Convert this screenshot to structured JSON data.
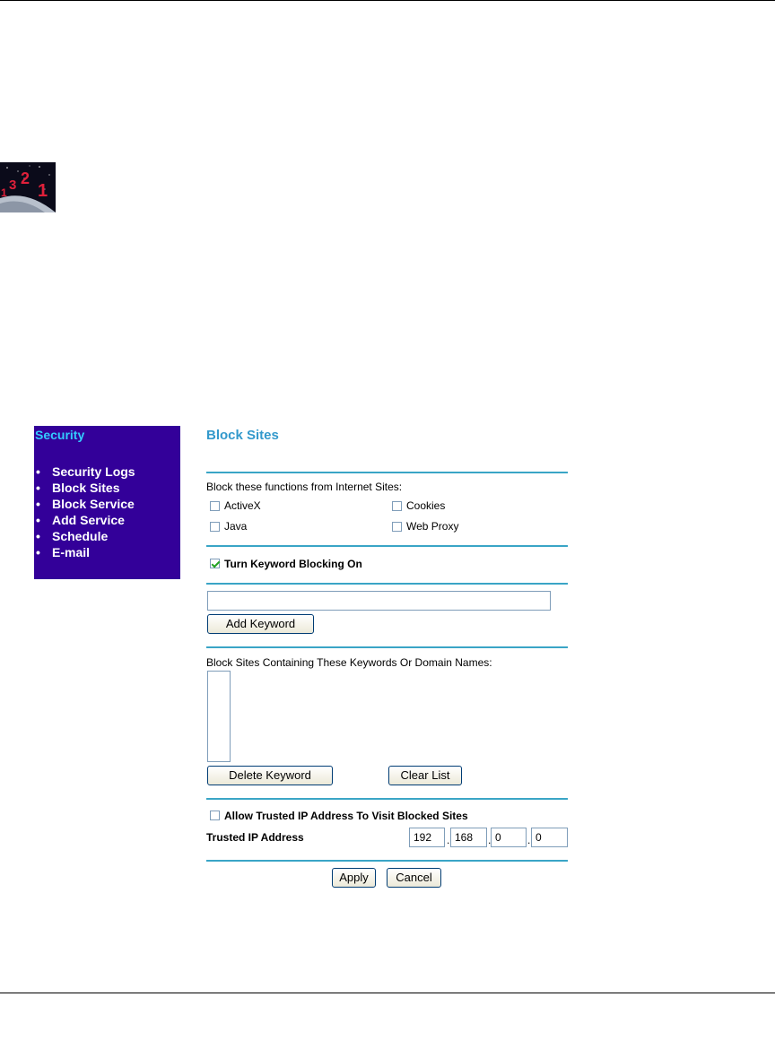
{
  "sidebar": {
    "title": "Security",
    "items": [
      {
        "label": "Security Logs"
      },
      {
        "label": "Block Sites"
      },
      {
        "label": "Block Service"
      },
      {
        "label": "Add Service"
      },
      {
        "label": "Schedule"
      },
      {
        "label": "E-mail"
      }
    ]
  },
  "main": {
    "title": "Block Sites",
    "block_functions_label": "Block these functions from Internet Sites:",
    "functions": {
      "activex": {
        "label": "ActiveX",
        "checked": false
      },
      "cookies": {
        "label": "Cookies",
        "checked": false
      },
      "java": {
        "label": "Java",
        "checked": false
      },
      "web_proxy": {
        "label": "Web Proxy",
        "checked": false
      }
    },
    "keyword_blocking": {
      "label": "Turn Keyword Blocking On",
      "checked": true
    },
    "keyword_input_value": "",
    "add_keyword_label": "Add Keyword",
    "list_label": "Block Sites Containing These Keywords Or Domain Names:",
    "list_items": [],
    "delete_keyword_label": "Delete Keyword",
    "clear_list_label": "Clear List",
    "trusted": {
      "allow_label": "Allow Trusted IP Address To Visit Blocked Sites",
      "allow_checked": false,
      "ip_label": "Trusted IP Address",
      "ip": [
        "192",
        "168",
        "0",
        "0"
      ]
    },
    "apply_label": "Apply",
    "cancel_label": "Cancel"
  },
  "logo": {
    "digits": [
      "1",
      "3",
      "2",
      "1"
    ],
    "digit_color": "#e0203a"
  },
  "colors": {
    "sidebar_bg": "#330099",
    "sidebar_title": "#33ccff",
    "accent": "#3399cc",
    "rule": "#3aa5c6"
  }
}
